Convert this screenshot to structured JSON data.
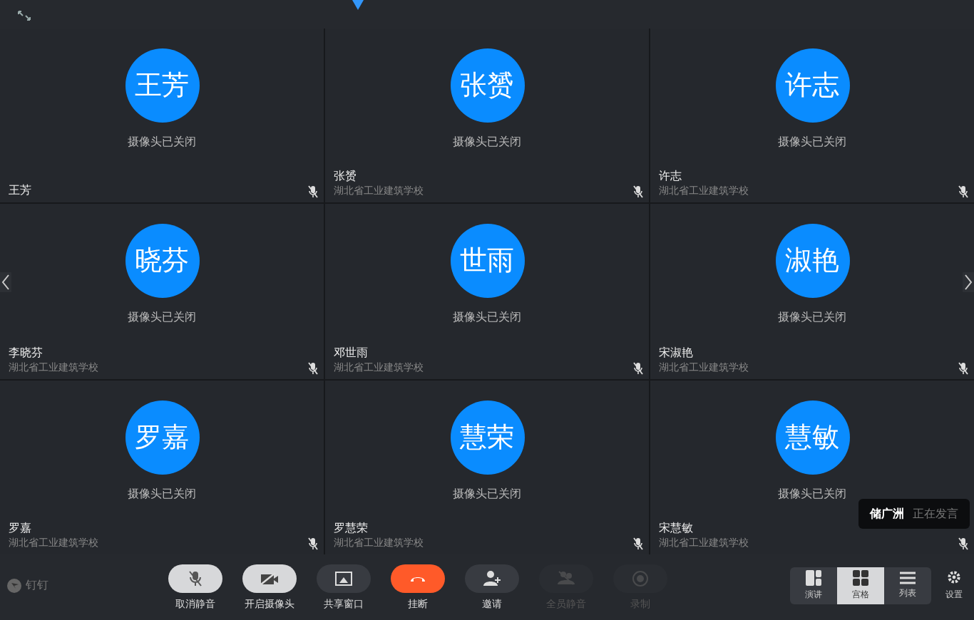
{
  "tiles": [
    {
      "avatar": "王芳",
      "camera_status": "摄像头已关闭",
      "name": "王芳",
      "mic_muted": true
    },
    {
      "avatar": "张赟",
      "camera_status": "摄像头已关闭",
      "name": "张赟",
      "org": "湖北省工业建筑学校",
      "mic_muted": true
    },
    {
      "avatar": "许志",
      "camera_status": "摄像头已关闭",
      "name": "许志",
      "org": "湖北省工业建筑学校",
      "mic_muted": true
    },
    {
      "avatar": "晓芬",
      "camera_status": "摄像头已关闭",
      "name": "李晓芬",
      "org": "湖北省工业建筑学校",
      "mic_muted": true
    },
    {
      "avatar": "世雨",
      "camera_status": "摄像头已关闭",
      "name": "邓世雨",
      "org": "湖北省工业建筑学校",
      "mic_muted": true
    },
    {
      "avatar": "淑艳",
      "camera_status": "摄像头已关闭",
      "name": "宋淑艳",
      "org": "湖北省工业建筑学校",
      "mic_muted": true
    },
    {
      "avatar": "罗嘉",
      "camera_status": "摄像头已关闭",
      "name": "罗嘉",
      "org": "湖北省工业建筑学校",
      "mic_muted": true
    },
    {
      "avatar": "慧荣",
      "camera_status": "摄像头已关闭",
      "name": "罗慧荣",
      "org": "湖北省工业建筑学校",
      "mic_muted": true
    },
    {
      "avatar": "慧敏",
      "camera_status": "摄像头已关闭",
      "name": "宋慧敏",
      "org": "湖北省工业建筑学校",
      "mic_muted": true
    }
  ],
  "speaking_toast": {
    "name": "储广洲",
    "status": "正在发言"
  },
  "brand": "钉钉",
  "controls": [
    {
      "kind": "mic",
      "label": "取消静音",
      "disabled": false
    },
    {
      "kind": "camera",
      "label": "开启摄像头",
      "disabled": false
    },
    {
      "kind": "share",
      "label": "共享窗口",
      "disabled": false
    },
    {
      "kind": "hangup",
      "label": "挂断",
      "disabled": false
    },
    {
      "kind": "invite",
      "label": "邀请",
      "disabled": false
    },
    {
      "kind": "muteall",
      "label": "全员静音",
      "disabled": true
    },
    {
      "kind": "record",
      "label": "录制",
      "disabled": true
    }
  ],
  "layouts": [
    {
      "kind": "speaker",
      "label": "演讲",
      "selected": false
    },
    {
      "kind": "grid",
      "label": "宫格",
      "selected": true
    },
    {
      "kind": "list",
      "label": "列表",
      "selected": false
    }
  ],
  "settings": {
    "label": "设置"
  }
}
